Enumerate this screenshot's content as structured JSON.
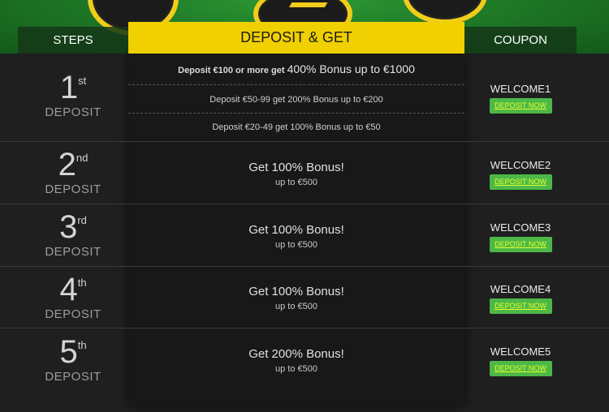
{
  "header": {
    "steps_label": "STEPS",
    "deposit_label": "DEPOSIT & GET",
    "coupon_label": "COUPON"
  },
  "first_deposit": {
    "number": "1",
    "suffix": "st",
    "label": "DEPOSIT",
    "tiers": [
      {
        "prefix": "Deposit €100 or more get",
        "highlight": "400% Bonus up to €1000"
      },
      {
        "text": "Deposit €50-99 get 200% Bonus up to €200"
      },
      {
        "text": "Deposit €20-49 get 100% Bonus up to €50"
      }
    ],
    "coupon": "WELCOME1",
    "button": "DEPOSIT NOW"
  },
  "steps": [
    {
      "number": "2",
      "suffix": "nd",
      "label": "DEPOSIT",
      "bonus": "Get 100% Bonus!",
      "limit": "up to €500",
      "coupon": "WELCOME2",
      "button": "DEPOSIT NOW"
    },
    {
      "number": "3",
      "suffix": "rd",
      "label": "DEPOSIT",
      "bonus": "Get 100% Bonus!",
      "limit": "up to €500",
      "coupon": "WELCOME3",
      "button": "DEPOSIT NOW"
    },
    {
      "number": "4",
      "suffix": "th",
      "label": "DEPOSIT",
      "bonus": "Get 100% Bonus!",
      "limit": "up to €500",
      "coupon": "WELCOME4",
      "button": "DEPOSIT NOW"
    },
    {
      "number": "5",
      "suffix": "th",
      "label": "DEPOSIT",
      "bonus": "Get 200% Bonus!",
      "limit": "up to €500",
      "coupon": "WELCOME5",
      "button": "DEPOSIT NOW"
    }
  ],
  "colors": {
    "accent": "#f0d000",
    "button": "#4cb848",
    "button_text": "#e8ff2a",
    "felt": "#1f7a27",
    "background": "#1f1f1f"
  }
}
